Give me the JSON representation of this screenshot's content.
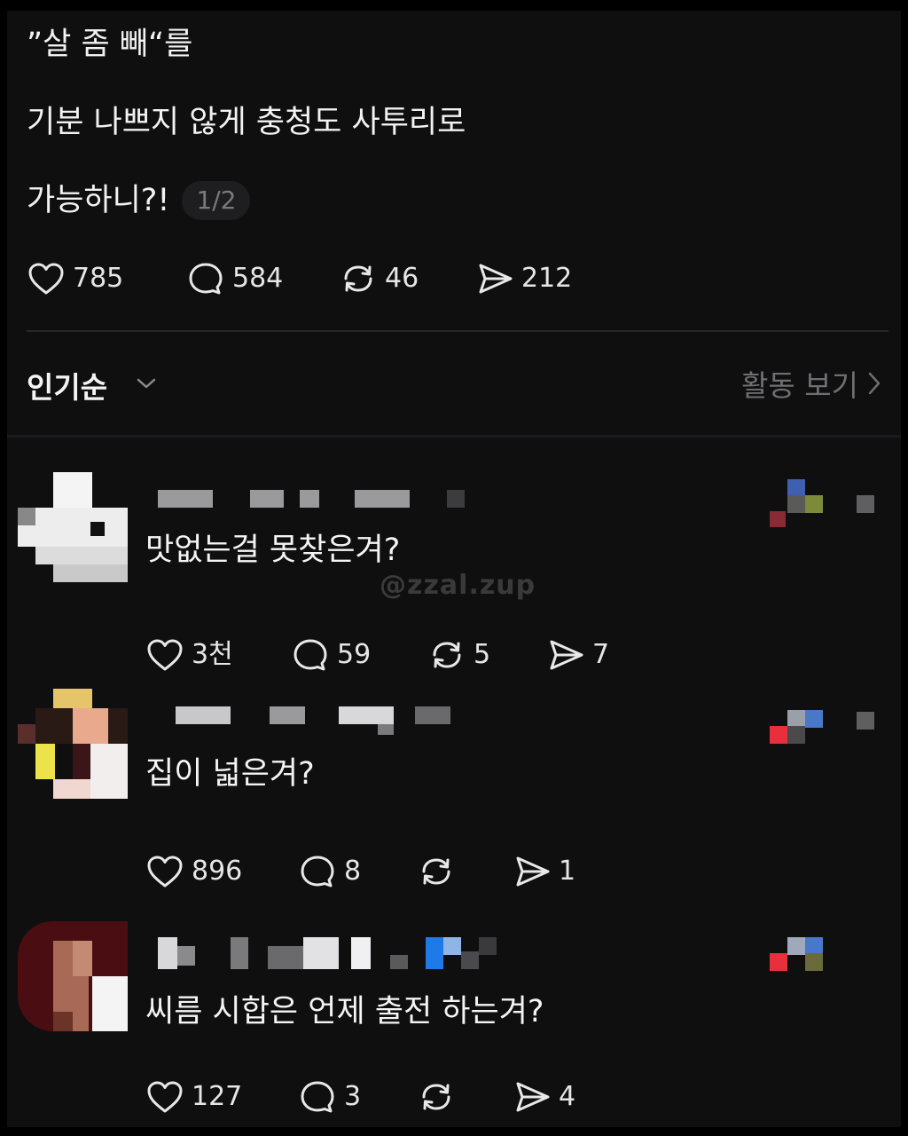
{
  "post": {
    "lines": [
      "”살 좀 빼“를",
      "기분 나쁘지 않게  충청도 사투리로",
      "가능하니?!"
    ],
    "page_indicator": "1/2",
    "likes": "785",
    "comments": "584",
    "reposts": "46",
    "shares": "212"
  },
  "sort": {
    "label": "인기순",
    "activity_label": "활동 보기"
  },
  "watermark": "@zzal.zup",
  "comments": [
    {
      "text": "맛없는걸 못찾은겨?",
      "likes": "3천",
      "replies": "59",
      "reposts": "5",
      "shares": "7"
    },
    {
      "text": "집이 넓은겨?",
      "likes": "896",
      "replies": "8",
      "reposts": "",
      "shares": "1"
    },
    {
      "text": "씨름 시합은 언제 출전 하는겨?",
      "likes": "127",
      "replies": "3",
      "reposts": "",
      "shares": "4"
    }
  ],
  "icons": {
    "like": "heart-icon",
    "reply": "speech-bubble-icon",
    "repost": "repost-arrows-icon",
    "share": "paper-plane-icon",
    "sort_expand": "chevron-down-icon",
    "activity_open": "chevron-right-icon"
  }
}
